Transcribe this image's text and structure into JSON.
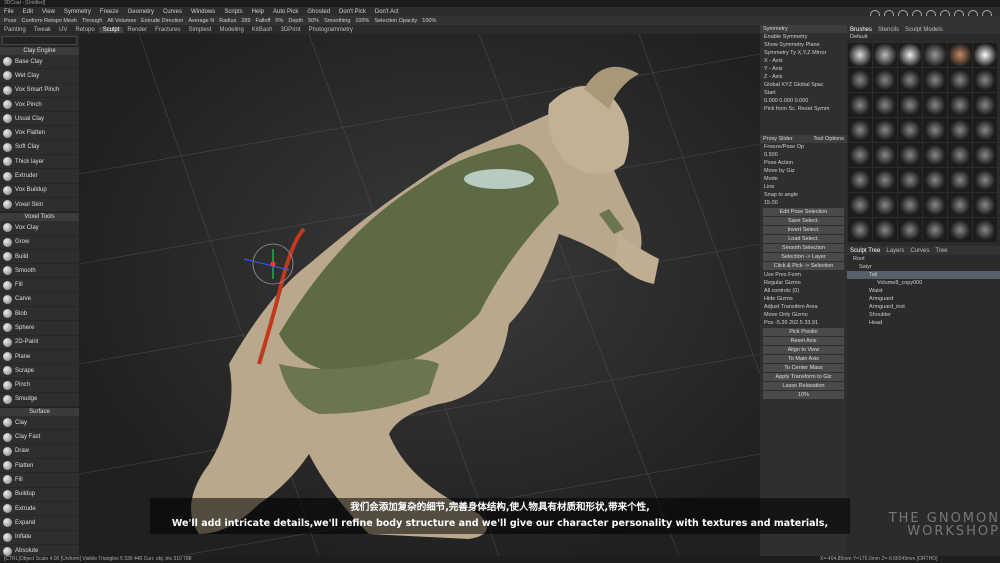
{
  "window_title": "3DCoat - [Untitled]",
  "menu": [
    "File",
    "Edit",
    "View",
    "Symmetry",
    "Freeze",
    "Geometry",
    "Curves",
    "Windows",
    "Scripts",
    "Help",
    "Auto Pick",
    "Ghosted",
    "Don't Pick",
    "Don't Act"
  ],
  "toolbar": [
    "Pose",
    "Conform Retopo Mesh",
    "Through",
    "All Volumes",
    "Extrude Direction",
    "Average N",
    "Radius",
    "289",
    "Falloff",
    "0%",
    "Depth",
    "50%",
    "Smoothing",
    "100%",
    "Selection Opacity",
    "100%"
  ],
  "tabs": [
    "Painting",
    "Tweak",
    "UV",
    "Retopo",
    "Sculpt",
    "Render",
    "Fractures",
    "Simplest",
    "Modeling",
    "KitBash",
    "3DPrint",
    "Photogrammetry"
  ],
  "active_tab": "Sculpt",
  "left": {
    "clay_header": "Clay Engine",
    "clay_tools": [
      "Base Clay",
      "Wet Clay",
      "Vox Smart Pinch",
      "Vox Pinch",
      "Usual Clay",
      "Vox Flatten",
      "Soft Clay",
      "Thick layer",
      "Extruder",
      "Vox Buildup",
      "Voxel Skin"
    ],
    "voxel_header": "Voxel Tools",
    "voxel_tools": [
      "Vox Clay",
      "Grow",
      "Build",
      "Smooth",
      "Fill",
      "Carve",
      "Blob",
      "Sphere",
      "2D-Paint",
      "Plane",
      "Scrape",
      "Pinch",
      "Smudge"
    ],
    "surface_header": "Surface",
    "surface_tools": [
      "Clay",
      "Clay Fast",
      "Draw",
      "Flatten",
      "Fill",
      "Buildup",
      "Extrude",
      "Expand",
      "Inflate",
      "Absolute"
    ]
  },
  "symmetry": {
    "title": "Symmetry",
    "rows": [
      "Enable Symmetry",
      "Show Symmetry Plane",
      "Symmetry Ty X,Y,Z Mirror",
      "X - Axis",
      "Y - Axis",
      "Z - Axis",
      "Global XYZ  Global Spac",
      "Start",
      "0.000 0.000 0.000",
      "Pick from Sc. Reset Symm"
    ]
  },
  "tool_options": {
    "tabs": [
      "Proxy Slider",
      "Tool Options"
    ],
    "rows": [
      "Freeze/Pose Op",
      "0.500",
      "Pose Action",
      "Move by Giz",
      "Mode",
      "Line",
      "Snap to angle",
      "15.00"
    ],
    "buttons": [
      "Edit Pose Selection",
      "Save Select.",
      "Invert Select.",
      "Load Select.",
      "Smooth Selection",
      "Selection -> Layer",
      "Click & Pick -> Selection"
    ],
    "rows2": [
      "Use Pres Form",
      "Regular Gizmo",
      "All controls (0)",
      "Hide Gizmo",
      "Adjust Transition Area",
      "Move Only Gizmo"
    ],
    "pos": "Pos  -5.36  202.5  33.91",
    "more": [
      "Pick Positio",
      "Reset Axis",
      "Align to View",
      "To Main Axis",
      "To Center Mass",
      "Apply Transform to Giz",
      "Lasso Relaxation",
      "10%"
    ]
  },
  "brushes": {
    "tabs": [
      "Brushes",
      "Stencils",
      "Sculpt Models"
    ],
    "preset": "Default"
  },
  "scene": {
    "tabs": [
      "Sculpt Tree",
      "Layers",
      "Curves",
      "Tree"
    ],
    "items": [
      "Root",
      "Satyr",
      "Tail",
      "Volume8_copy000",
      "Waist",
      "Armguard",
      "Armguard_inst",
      "Shoulder",
      "Head"
    ],
    "active": "Tail"
  },
  "subtitles": {
    "zh": "我们会添加复杂的细节,完善身体结构,使人物具有材质和形状,带来个性,",
    "en": "We'll add intricate details,we'll refine body structure and we'll give our character personality with textures and materials,"
  },
  "watermark": [
    "THE GNOMON",
    "WORKSHOP"
  ],
  "statusbar": "[CTRL]Object Scale  4.00  [Uniform]  Visible Triangles  5 330 440  Curr. obj. tris  310 788",
  "statusbar_right": "X=-404.89mm  Y=176.0mm  Z=-8.66549mm  [ORTHO]"
}
